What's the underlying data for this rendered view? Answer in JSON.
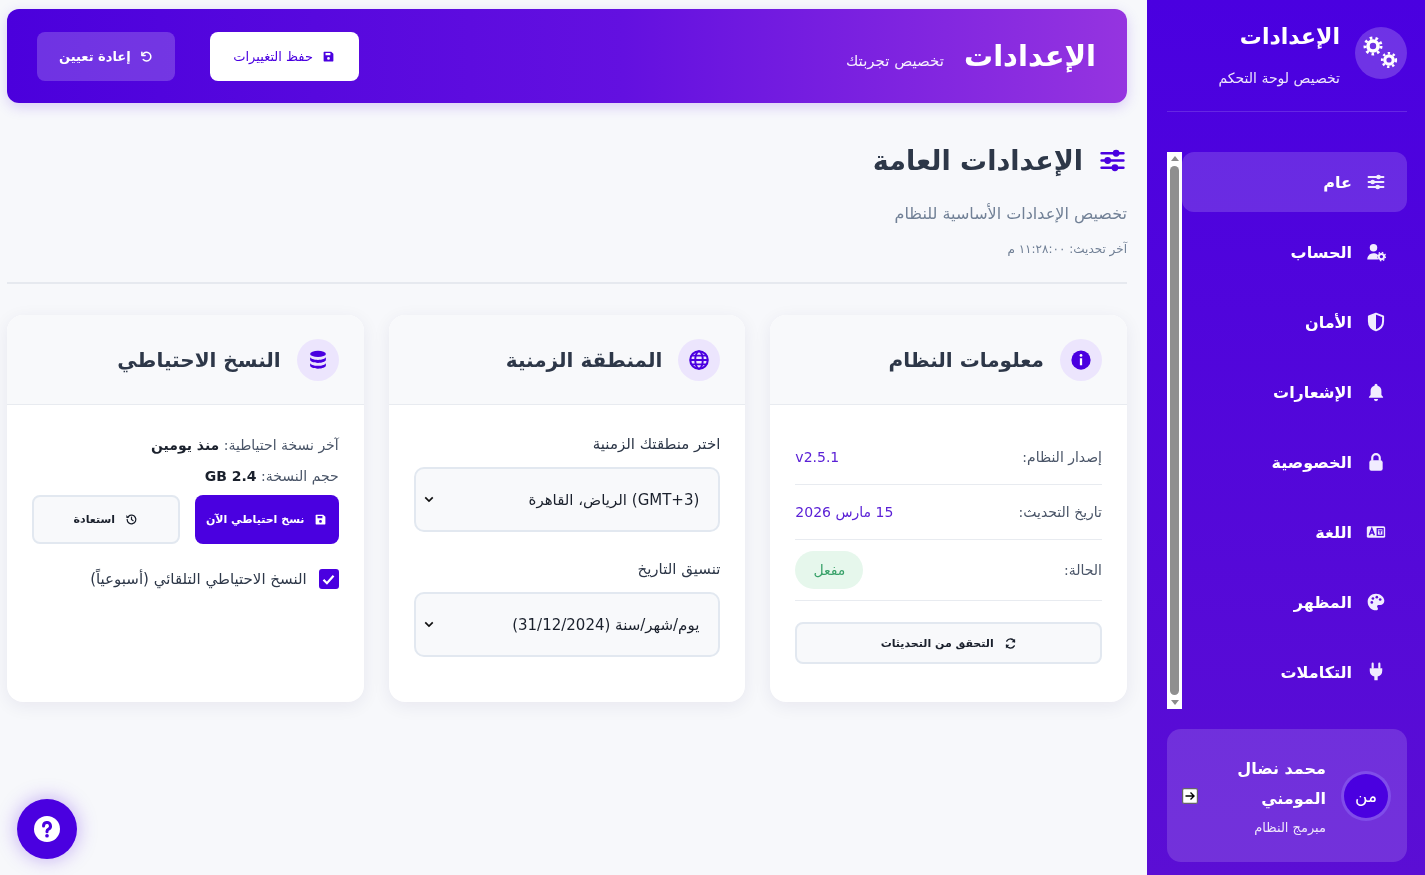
{
  "header": {
    "title": "الإعدادات",
    "subtitle": "تخصيص تجربتك",
    "buttons": [
      {
        "label": "حفظ التغييرات",
        "kind": "primary"
      },
      {
        "label": "إعادة تعيين",
        "kind": "secondary"
      }
    ]
  },
  "section": {
    "title": "الإعدادات العامة",
    "subtitle": "تخصيص الإعدادات الأساسية للنظام",
    "last_updated": "آخر تحديث: ١١:٢٨:٠٠ م"
  },
  "cards": [
    {
      "kind": "info",
      "title": "معلومات النظام",
      "rows": [
        {
          "label": "إصدار النظام:",
          "value": "v2.5.1",
          "kind": "text"
        },
        {
          "label": "تاريخ التحديث:",
          "value": "15 مارس 2026",
          "kind": "text"
        },
        {
          "label": "الحالة:",
          "value": "مفعل",
          "kind": "badge"
        }
      ],
      "button": "التحقق من التحديثات"
    },
    {
      "kind": "form",
      "title": "المنطقة الزمنية",
      "fields": [
        {
          "label": "اختر منطقتك الزمنية",
          "value": "(GMT+3) الرياض، القاهرة"
        },
        {
          "label": "تنسيق التاريخ",
          "value": "يوم/شهر/سنة (31/12/2024)"
        }
      ]
    },
    {
      "kind": "backup",
      "title": "النسخ الاحتياطي",
      "lines": [
        "آخر نسخة احتياطية: **منذ يومين**",
        "حجم النسخة: **2.4 GB**"
      ],
      "buttons": [
        {
          "label": "نسخ احتياطي الآن",
          "kind": "primary"
        },
        {
          "label": "استعادة",
          "kind": "secondary"
        }
      ],
      "checkbox": {
        "label": "النسخ الاحتياطي التلقائي (أسبوعياً)",
        "checked": true
      }
    }
  ],
  "sidebar": {
    "title": "الإعدادات",
    "subtitle": "تخصيص لوحة التحكم",
    "items": [
      {
        "label": "عام",
        "selected": true
      },
      {
        "label": "الحساب",
        "selected": false
      },
      {
        "label": "الأمان",
        "selected": false
      },
      {
        "label": "الإشعارات",
        "selected": false
      },
      {
        "label": "الخصوصية",
        "selected": false
      },
      {
        "label": "اللغة",
        "selected": false
      },
      {
        "label": "المظهر",
        "selected": false
      },
      {
        "label": "التكاملات",
        "selected": false
      }
    ],
    "user": {
      "avatar": "من",
      "name": "محمد نضال المومني",
      "role": "مبرمج النظام"
    }
  }
}
